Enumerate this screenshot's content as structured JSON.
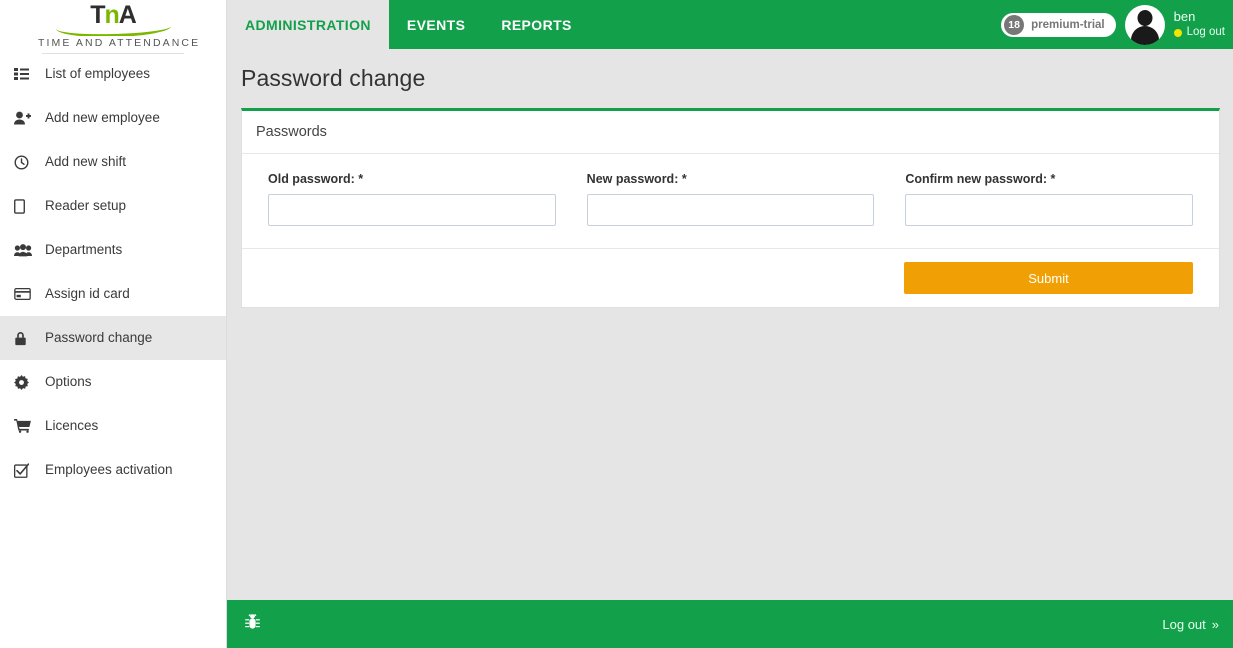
{
  "brand": {
    "mark_pre": "T",
    "mark_n": "n",
    "mark_post": "A",
    "subtitle": "TIME AND ATTENDANCE",
    "logo_icon": "tna-logo-icon",
    "swoosh_color": "#7ab800"
  },
  "sidebar": {
    "items": [
      {
        "label": "List of employees",
        "icon": "list-icon",
        "active": false
      },
      {
        "label": "Add new employee",
        "icon": "user-plus-icon",
        "active": false
      },
      {
        "label": "Add new shift",
        "icon": "clock-icon",
        "active": false
      },
      {
        "label": "Reader setup",
        "icon": "tablet-icon",
        "active": false
      },
      {
        "label": "Departments",
        "icon": "users-icon",
        "active": false
      },
      {
        "label": "Assign id card",
        "icon": "credit-card-icon",
        "active": false
      },
      {
        "label": "Password change",
        "icon": "lock-icon",
        "active": true
      },
      {
        "label": "Options",
        "icon": "gear-icon",
        "active": false
      },
      {
        "label": "Licences",
        "icon": "cart-icon",
        "active": false
      },
      {
        "label": "Employees activation",
        "icon": "check-square-icon",
        "active": false
      }
    ]
  },
  "topbar": {
    "tabs": [
      {
        "label": "ADMINISTRATION",
        "active": true
      },
      {
        "label": "EVENTS",
        "active": false
      },
      {
        "label": "REPORTS",
        "active": false
      }
    ],
    "plan": {
      "count": "18",
      "label": "premium-trial"
    },
    "user": {
      "name": "ben",
      "logout_label": "Log out",
      "status_dot_color": "#f2e600",
      "avatar_icon": "avatar-icon"
    }
  },
  "page": {
    "title": "Password change"
  },
  "panel": {
    "heading": "Passwords",
    "fields": [
      {
        "label": "Old password: *",
        "value": "",
        "placeholder": ""
      },
      {
        "label": "New password: *",
        "value": "",
        "placeholder": ""
      },
      {
        "label": "Confirm new password: *",
        "value": "",
        "placeholder": ""
      }
    ],
    "submit_label": "Submit"
  },
  "footer": {
    "bug_icon": "bug-icon",
    "logout_label": "Log out",
    "logout_chevron": "»"
  },
  "colors": {
    "brand_green": "#13a04b",
    "accent_orange": "#f0a005",
    "page_bg": "#e5e5e5",
    "active_item_bg": "#e7e7e7"
  }
}
